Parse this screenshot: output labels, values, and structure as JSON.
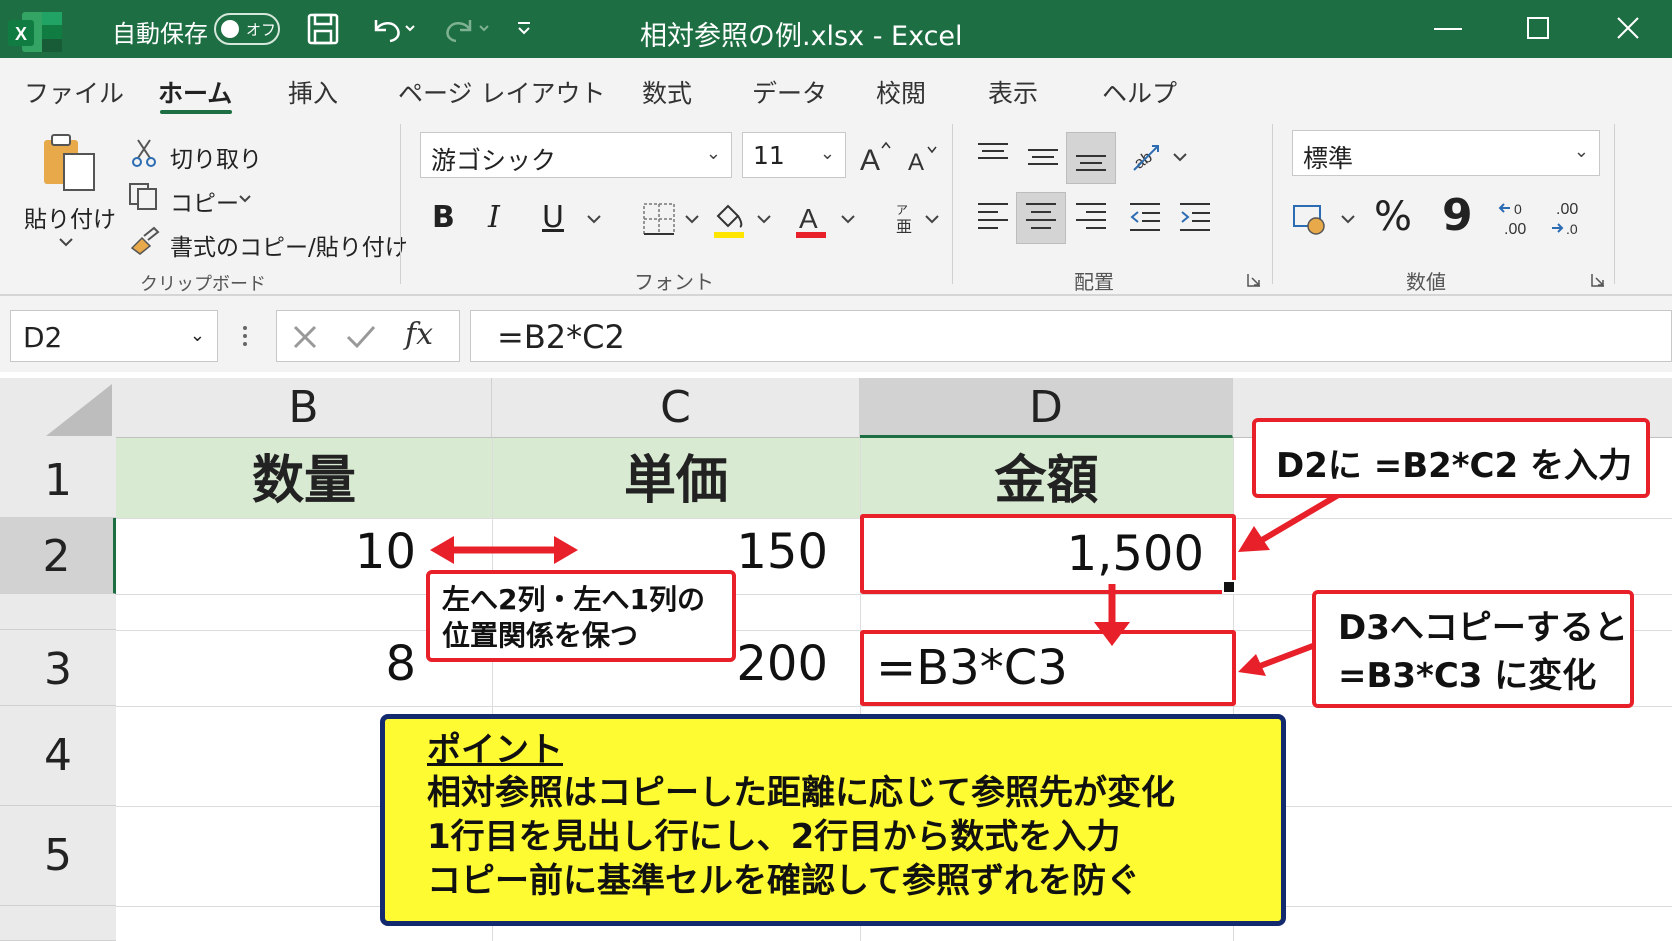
{
  "titlebar": {
    "autosave_label": "自動保存",
    "autosave_toggle": "オフ",
    "title": "相対参照の例.xlsx  -  Excel",
    "bg_color": "#1e6e43"
  },
  "tabs": [
    "ファイル",
    "ホーム",
    "挿入",
    "ページ レイアウト",
    "数式",
    "データ",
    "校閲",
    "表示",
    "ヘルプ"
  ],
  "active_tab": "ホーム",
  "ribbon": {
    "clipboard": {
      "paste": "貼り付け",
      "cut": "切り取り",
      "copy": "コピー",
      "format_painter": "書式のコピー/貼り付け",
      "group_label": "クリップボード"
    },
    "font": {
      "font_name": "游ゴシック",
      "font_size": "11",
      "bold": "B",
      "italic": "I",
      "underline": "U",
      "group_label": "フォント"
    },
    "alignment": {
      "group_label": "配置"
    },
    "number": {
      "format": "標準",
      "percent": "%",
      "comma": "9",
      "group_label": "数値"
    }
  },
  "formula_bar": {
    "name_box": "D2",
    "fx": "fx",
    "formula": "=B2*C2"
  },
  "sheet": {
    "columns": [
      "B",
      "C",
      "D"
    ],
    "rows": [
      "1",
      "2",
      "3",
      "4",
      "5"
    ],
    "headers": [
      "数量",
      "単価",
      "金額"
    ],
    "row2": {
      "B": "10",
      "C": "150",
      "D": "1,500"
    },
    "row3": {
      "B": "8",
      "C": "200",
      "D": "=B3*C3"
    },
    "header_fill": "#d9ead3"
  },
  "annotations": {
    "offset_note": [
      "左へ2列・左へ1列の",
      "位置関係を保つ"
    ],
    "d2_note": "D2に =B2*C2 を入力",
    "d3_note": [
      "D3へコピーすると",
      "=B3*C3 に変化"
    ],
    "accent_red": "#e8202a"
  },
  "point_box": {
    "title": "ポイント",
    "lines": [
      "相対参照はコピーした距離に応じて参照先が変化",
      "1行目を見出し行にし、2行目から数式を入力",
      "コピー前に基準セルを確認して参照ずれを防ぐ"
    ],
    "bg": "#fffb33",
    "border": "#132a6e"
  }
}
